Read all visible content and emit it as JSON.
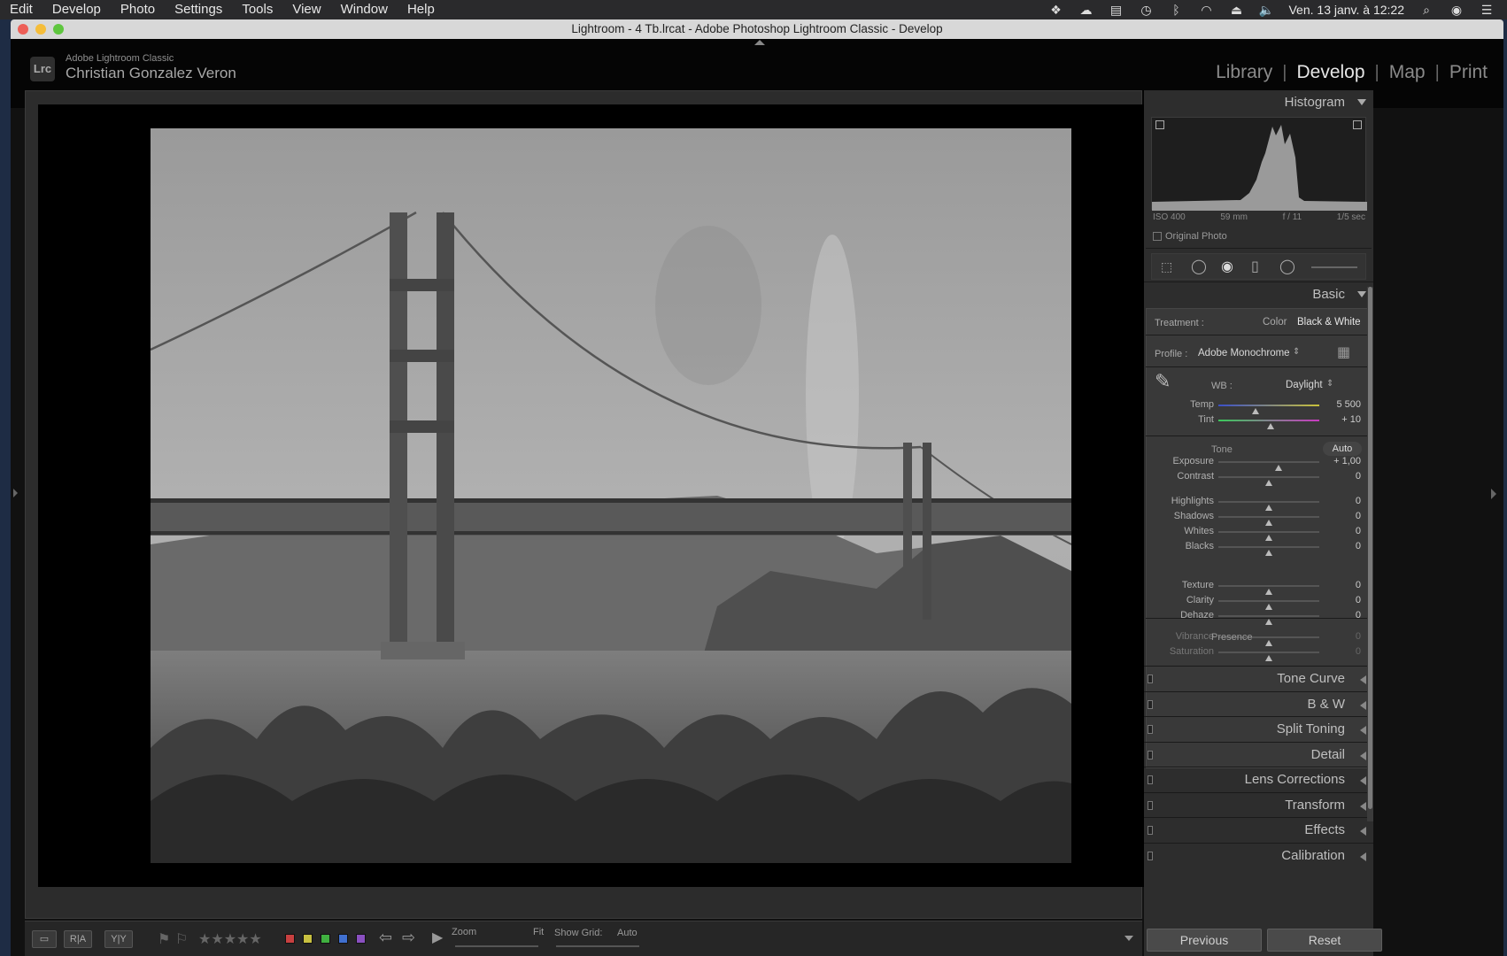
{
  "menubar": {
    "items": [
      "Edit",
      "Develop",
      "Photo",
      "Settings",
      "Tools",
      "View",
      "Window",
      "Help"
    ],
    "clock": "Ven. 13 janv. à 12:22"
  },
  "window": {
    "title": "Lightroom - 4 Tb.lrcat - Adobe Photoshop Lightroom Classic - Develop"
  },
  "identity": {
    "logo": "Lrc",
    "app_name": "Adobe Lightroom Classic",
    "user_name": "Christian Gonzalez Veron"
  },
  "modules": {
    "library": "Library",
    "develop": "Develop",
    "map": "Map",
    "print": "Print",
    "active": "Develop"
  },
  "histogram": {
    "title": "Histogram",
    "iso": "ISO 400",
    "focal": "59 mm",
    "aperture": "f / 11",
    "shutter": "1/5 sec",
    "original_photo": "Original Photo"
  },
  "basic": {
    "title": "Basic",
    "treatment_label": "Treatment :",
    "treatment_color": "Color",
    "treatment_bw": "Black & White",
    "profile_label": "Profile :",
    "profile_value": "Adobe Monochrome",
    "wb_label": "WB :",
    "wb_value": "Daylight",
    "tone_label": "Tone",
    "auto_label": "Auto",
    "presence_label": "Presence",
    "sliders": [
      {
        "label": "Temp",
        "value": "5 500",
        "pos": 0.37
      },
      {
        "label": "Tint",
        "value": "+ 10",
        "pos": 0.52
      },
      {
        "label": "Exposure",
        "value": "+ 1,00",
        "pos": 0.6
      },
      {
        "label": "Contrast",
        "value": "0",
        "pos": 0.5
      },
      {
        "label": "Highlights",
        "value": "0",
        "pos": 0.5
      },
      {
        "label": "Shadows",
        "value": "0",
        "pos": 0.5
      },
      {
        "label": "Whites",
        "value": "0",
        "pos": 0.5
      },
      {
        "label": "Blacks",
        "value": "0",
        "pos": 0.5
      },
      {
        "label": "Texture",
        "value": "0",
        "pos": 0.5
      },
      {
        "label": "Clarity",
        "value": "0",
        "pos": 0.5
      },
      {
        "label": "Dehaze",
        "value": "0",
        "pos": 0.5
      },
      {
        "label": "Vibrance",
        "value": "0",
        "pos": 0.5
      },
      {
        "label": "Saturation",
        "value": "0",
        "pos": 0.5
      }
    ]
  },
  "panels": [
    "Tone Curve",
    "B & W",
    "Split Toning",
    "Detail",
    "Lens Corrections",
    "Transform",
    "Effects",
    "Calibration"
  ],
  "toolbar": {
    "zoom_label": "Zoom",
    "zoom_fit": "Fit",
    "show_grid_label": "Show Grid:",
    "show_grid_value": "Auto",
    "ra": "R|A",
    "yy": "Y|Y"
  },
  "buttons": {
    "previous": "Previous",
    "reset": "Reset"
  },
  "colors": {
    "labels": [
      "#c84040",
      "#c8c040",
      "#40b040",
      "#4070d0",
      "#8a50c0"
    ]
  }
}
